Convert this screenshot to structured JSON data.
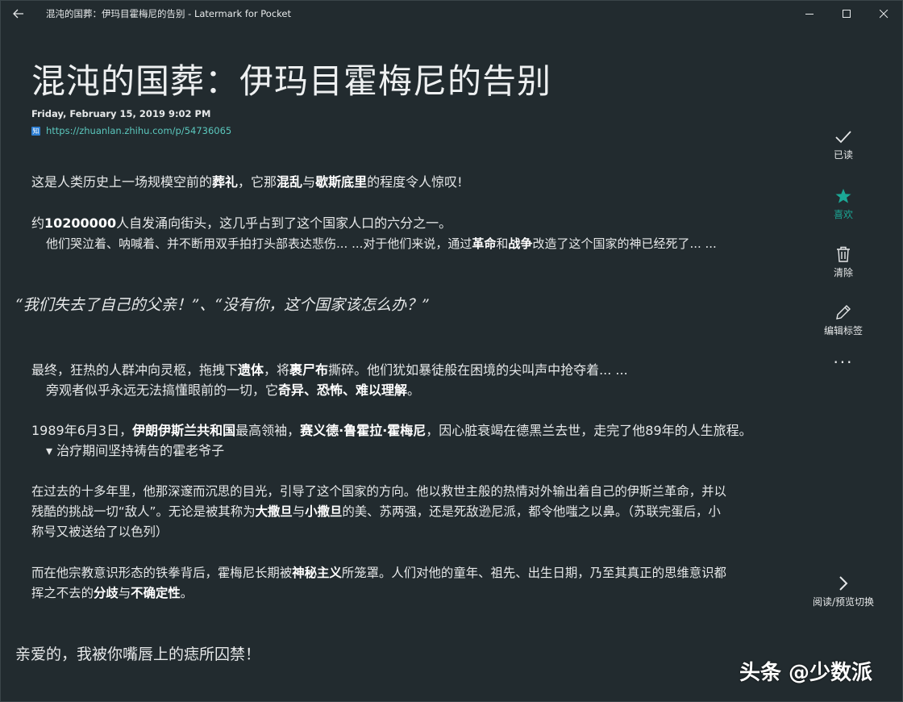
{
  "window": {
    "title": "混沌的国葬：伊玛目霍梅尼的告别 - Latermark for Pocket",
    "back_icon": "arrow-left-icon",
    "controls": [
      "minimize-icon",
      "maximize-icon",
      "close-icon"
    ]
  },
  "article": {
    "headline": "混沌的国葬：伊玛目霍梅尼的告别",
    "date": "Friday, February 15, 2019 9:02 PM",
    "source_icon_text": "知",
    "source_url": "https://zhuanlan.zhihu.com/p/54736065",
    "para1": [
      "这是人类历史上一场规模空前的",
      "葬礼",
      "，它那",
      "混乱",
      "与",
      "歇斯底里",
      "的程度令人惊叹!"
    ],
    "para2a": [
      "约",
      "10200000",
      "人自发涌向街头，这几乎占到了这个国家人口的六分之一。"
    ],
    "para2b": [
      "他们哭泣着、呐喊着、并不断用双手拍打头部表达悲伤... ...对于他们来说，通过",
      "革命",
      "和",
      "战争",
      "改造了这个国家的神已经死了... ..."
    ],
    "quote": "“我们失去了自己的父亲！”、“没有你，这个国家该怎么办？”",
    "para3a": [
      "最终，狂热的人群冲向灵柩，拖拽下",
      "遗体",
      "，将",
      "裹尸布",
      "撕碎。他们犹如暴徒般在困境的尖叫声中抢夺着... ..."
    ],
    "para3b": [
      "旁观者似乎永远无法搞懂眼前的一切，它",
      "奇异、恐怖、难以理解",
      "。"
    ],
    "para4": [
      "1989年6月3日，",
      "伊朗伊斯兰共和国",
      "最高领袖，",
      "赛义德·鲁霍拉·霍梅尼",
      "，因心脏衰竭在德黑兰去世，走完了他89年的人生旅程。"
    ],
    "caption": "▾ 治疗期间坚持祷告的霍老爷子",
    "para5a": "在过去的十多年里，他那深邃而沉思的目光，引导了这个国家的方向。他以救世主般的热情对外输出着自己的伊斯兰革命，并以",
    "para5b": [
      "残酷的挑战一切“敌人”。无论是被其称为",
      "大撒旦",
      "与",
      "小撒旦",
      "的美、苏两强，还是死敌逊尼派，都令他嗤之以鼻。（苏联完蛋后，小"
    ],
    "para5c": "称号又被送给了以色列）",
    "para6a": [
      "而在他宗教意识形态的铁拳背后，霍梅尼长期被",
      "神秘主义",
      "所笼罩。人们对他的童年、祖先、出生日期，乃至其真正的思维意识都"
    ],
    "para6b": [
      "挥之不去的",
      "分歧",
      "与",
      "不确定性",
      "。"
    ],
    "closing": "亲爱的，我被你嘴唇上的痣所囚禁！"
  },
  "rail": {
    "read": {
      "icon": "check-icon",
      "label": "已读"
    },
    "favorite": {
      "icon": "star-icon",
      "label": "喜欢",
      "color": "#1ba896"
    },
    "delete": {
      "icon": "trash-icon",
      "label": "清除"
    },
    "edit_tags": {
      "icon": "pencil-icon",
      "label": "编辑标签"
    },
    "more": {
      "icon": "more-icon",
      "label": "···"
    },
    "toggle": {
      "icon": "chevron-right-icon",
      "label": "阅读/预览切换"
    }
  },
  "watermark": "头条 @少数派"
}
